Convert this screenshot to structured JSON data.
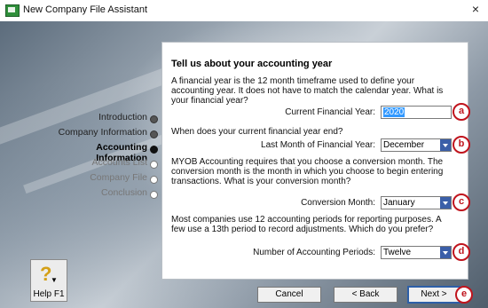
{
  "window": {
    "title": "New Company File Assistant",
    "close_glyph": "×"
  },
  "nav": {
    "items": [
      {
        "label": "Introduction",
        "state": "done"
      },
      {
        "label": "Company Information",
        "state": "done"
      },
      {
        "label": "Accounting Information",
        "state": "active"
      },
      {
        "label": "Accounts List",
        "state": "pending"
      },
      {
        "label": "Company File",
        "state": "pending"
      },
      {
        "label": "Conclusion",
        "state": "pending"
      }
    ]
  },
  "panel": {
    "heading": "Tell us about your accounting year",
    "intro": "A financial year is the 12 month timeframe used to define your accounting year.  It does not have to match the calendar year.  What is your financial year?",
    "current_year_label": "Current Financial Year:",
    "current_year_value": "2020",
    "end_question": "When does your current financial year end?",
    "last_month_label": "Last Month of Financial Year:",
    "last_month_value": "December",
    "conversion_text": "MYOB Accounting requires that you choose a conversion month.  The conversion month is the month in which you choose to begin entering transactions.  What is your conversion month?",
    "conversion_label": "Conversion Month:",
    "conversion_value": "January",
    "periods_text": "Most companies use 12 accounting periods for reporting purposes.  A few use a 13th period to record adjustments.  Which do you prefer?",
    "periods_label": "Number of Accounting Periods:",
    "periods_value": "Twelve"
  },
  "badges": {
    "a": "a",
    "b": "b",
    "c": "c",
    "d": "d",
    "e": "e"
  },
  "buttons": {
    "help": "Help F1",
    "cancel": "Cancel",
    "back": "< Back",
    "next": "Next >"
  },
  "colors": {
    "badge": "#c0141d",
    "selection": "#3399ff",
    "dropdown_button": "#3b5fa8"
  }
}
